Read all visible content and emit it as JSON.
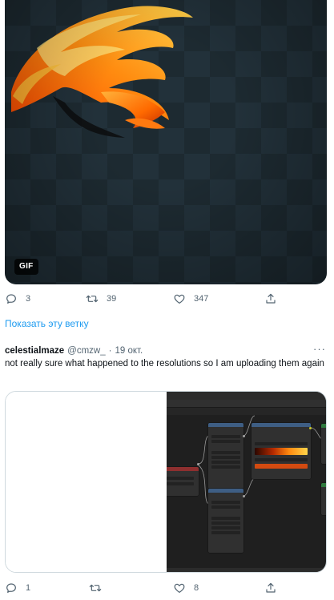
{
  "tweet1": {
    "media_badge": "GIF",
    "actions": {
      "replies": "3",
      "retweets": "39",
      "likes": "347"
    },
    "show_thread": "Показать эту ветку"
  },
  "tweet2": {
    "display_name": "celestialmaze",
    "handle": "@cmzw_",
    "separator": "·",
    "date": "19 окт.",
    "more": "···",
    "text": "not really sure what happened to the resolutions so I am uploading them again",
    "actions": {
      "replies": "1",
      "retweets": "",
      "likes": "8"
    }
  },
  "colors": {
    "link": "#1d9bf0",
    "muted": "#536471",
    "text": "#0f1419"
  },
  "icons": [
    "reply-icon",
    "retweet-icon",
    "like-icon",
    "share-icon",
    "more-icon"
  ]
}
